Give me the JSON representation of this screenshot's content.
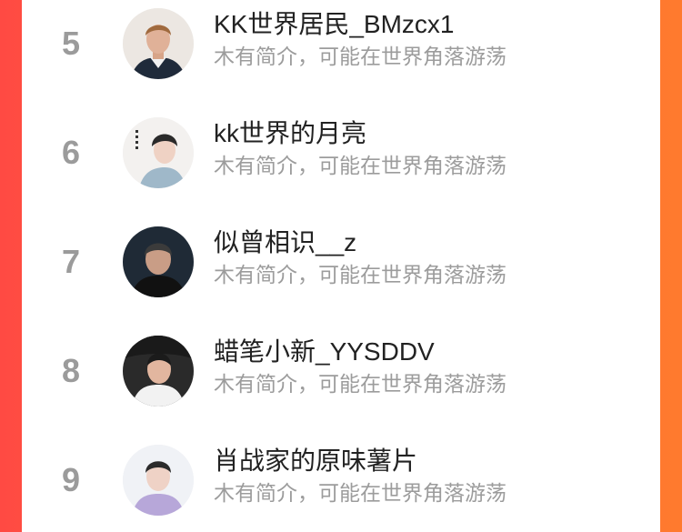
{
  "ranking_list": {
    "items": [
      {
        "rank": "5",
        "username": "KK世界居民_BMzcx1",
        "bio": "木有简介，可能在世界角落游荡",
        "avatar_icon": "user-avatar-icon"
      },
      {
        "rank": "6",
        "username": "kk世界的月亮",
        "bio": "木有简介，可能在世界角落游荡",
        "avatar_icon": "user-avatar-icon"
      },
      {
        "rank": "7",
        "username": "似曾相识__z",
        "bio": "木有简介，可能在世界角落游荡",
        "avatar_icon": "user-avatar-icon"
      },
      {
        "rank": "8",
        "username": "蜡笔小新_YYSDDV",
        "bio": "木有简介，可能在世界角落游荡",
        "avatar_icon": "user-avatar-icon"
      },
      {
        "rank": "9",
        "username": "肖战家的原味薯片",
        "bio": "木有简介，可能在世界角落游荡",
        "avatar_icon": "user-avatar-icon"
      }
    ]
  },
  "colors": {
    "background_left": "#ff4a43",
    "background_right": "#ff7a2e",
    "panel": "#ffffff",
    "rank_text": "#9b9b9b",
    "name_text": "#222222",
    "bio_text": "#9c9c9c"
  }
}
